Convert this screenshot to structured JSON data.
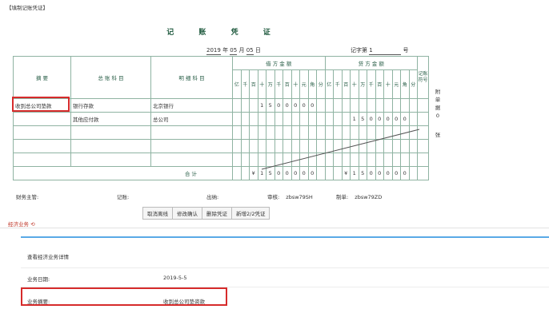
{
  "panel_title": "【填制记账凭证】",
  "voucher": {
    "title": "记 账 凭 证",
    "date": {
      "year": "2019",
      "year_unit": "年",
      "month": "05",
      "month_unit": "月",
      "day": "05",
      "day_unit": "日"
    },
    "voucher_no_label": "记字第",
    "voucher_no": "1",
    "voucher_no_unit": "号",
    "headers": {
      "summary": "摘 要",
      "general_account": "总 账 科 目",
      "detail_account": "明 细 科 目",
      "debit": "借 方 金 额",
      "credit": "贷 方 金 额",
      "bookkeeping": "记账符号"
    },
    "digit_units": [
      "亿",
      "千",
      "百",
      "十",
      "万",
      "千",
      "百",
      "十",
      "元",
      "角",
      "分"
    ],
    "rows": [
      {
        "summary": "收到总公司垫款",
        "general": "银行存款",
        "detail": "北京银行",
        "debit": [
          "",
          "",
          "",
          "1",
          "5",
          "0",
          "0",
          "0",
          "0",
          "0",
          ""
        ],
        "credit": [
          "",
          "",
          "",
          "",
          "",
          "",
          "",
          "",
          "",
          "",
          ""
        ]
      },
      {
        "summary": "",
        "general": "其他应付款",
        "detail": "总公司",
        "debit": [
          "",
          "",
          "",
          "",
          "",
          "",
          "",
          "",
          "",
          "",
          ""
        ],
        "credit": [
          "",
          "",
          "",
          "1",
          "5",
          "0",
          "0",
          "0",
          "0",
          "0",
          ""
        ]
      },
      {
        "summary": "",
        "general": "",
        "detail": "",
        "debit": [
          "",
          "",
          "",
          "",
          "",
          "",
          "",
          "",
          "",
          "",
          ""
        ],
        "credit": [
          "",
          "",
          "",
          "",
          "",
          "",
          "",
          "",
          "",
          "",
          ""
        ]
      },
      {
        "summary": "",
        "general": "",
        "detail": "",
        "debit": [
          "",
          "",
          "",
          "",
          "",
          "",
          "",
          "",
          "",
          "",
          ""
        ],
        "credit": [
          "",
          "",
          "",
          "",
          "",
          "",
          "",
          "",
          "",
          "",
          ""
        ]
      },
      {
        "summary": "",
        "general": "",
        "detail": "",
        "debit": [
          "",
          "",
          "",
          "",
          "",
          "",
          "",
          "",
          "",
          "",
          ""
        ],
        "credit": [
          "",
          "",
          "",
          "",
          "",
          "",
          "",
          "",
          "",
          "",
          ""
        ]
      }
    ],
    "total_label": "合 计",
    "total_debit": [
      "",
      "",
      "¥",
      "1",
      "5",
      "0",
      "0",
      "0",
      "0",
      "0",
      ""
    ],
    "total_credit": [
      "",
      "",
      "¥",
      "1",
      "5",
      "0",
      "0",
      "0",
      "0",
      "0",
      ""
    ],
    "attachment": [
      "附",
      "单",
      "据",
      "0",
      "张"
    ],
    "signatures": {
      "supervisor": "财务主管:",
      "bookkeeper": "记账:",
      "cashier": "出纳:",
      "reviewer_label": "审核:",
      "reviewer": "zbsw79SH",
      "preparer_label": "制单:",
      "preparer": "zbsw79ZD"
    }
  },
  "buttons": [
    "取消离线",
    "修改确认",
    "删除凭证",
    "新增2/2凭证"
  ],
  "section_title": "经济业务 ⟲",
  "detail": {
    "title": "查看经济业务详情",
    "date_label": "业务日期:",
    "date_value": "2019-5-5",
    "summary_label": "业务摘要:",
    "summary_value": "收到总公司垫资款"
  },
  "colors": {
    "accent_blue": "#5aa9e6",
    "highlight_red": "#d62b2b",
    "header_green": "#2a5f48"
  }
}
